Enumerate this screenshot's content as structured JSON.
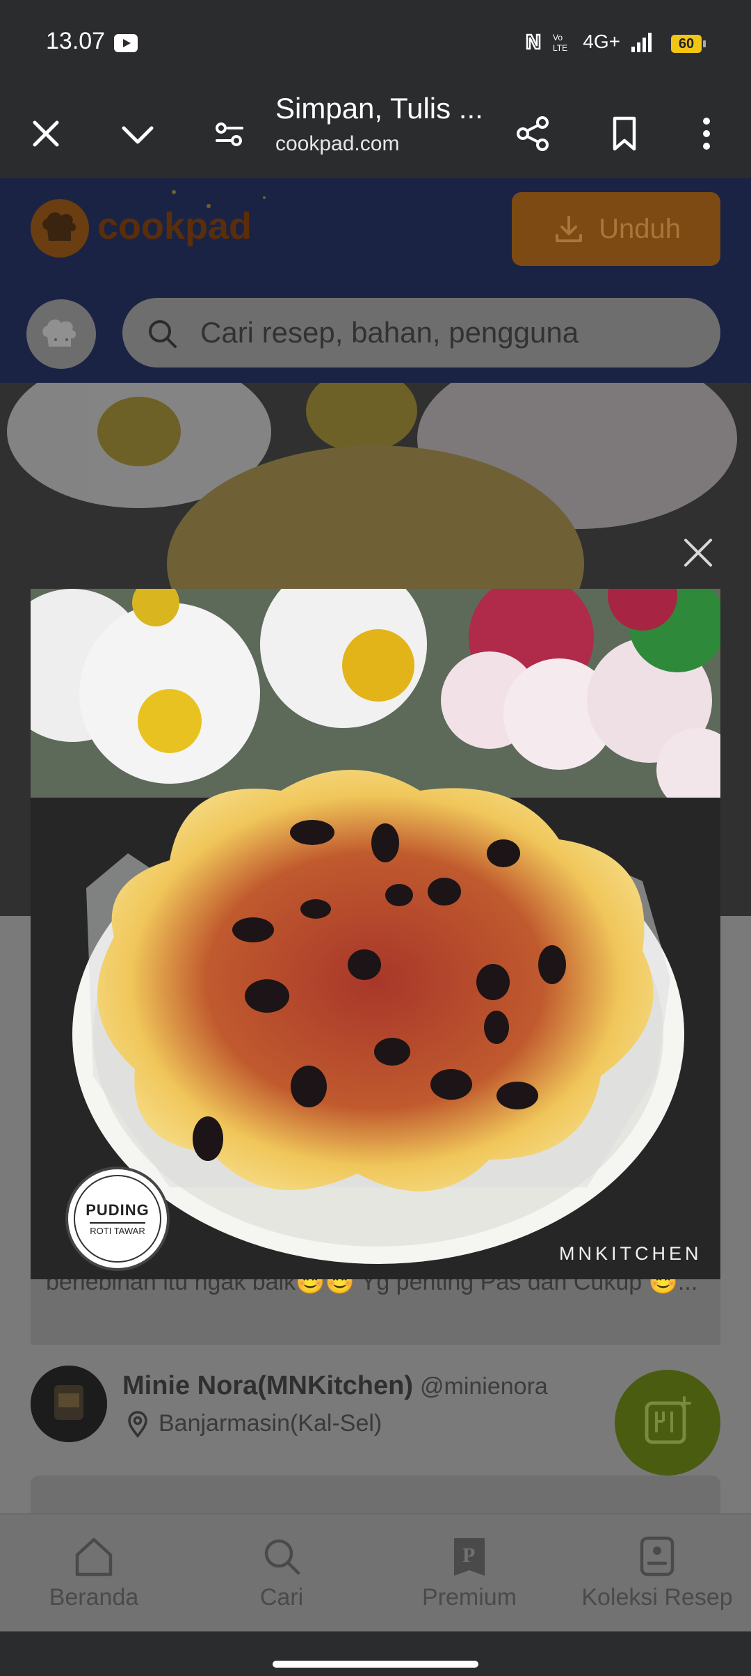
{
  "status_bar": {
    "time": "13.07",
    "network": "4G+",
    "battery": "60",
    "icons": [
      "youtube-icon",
      "nfc-icon",
      "volte-icon",
      "signal-icon",
      "battery-icon"
    ]
  },
  "toolbar": {
    "title": "Simpan, Tulis ...",
    "url": "cookpad.com",
    "icons": [
      "close-icon",
      "chevron-down-icon",
      "page-settings-icon",
      "share-icon",
      "bookmark-icon",
      "more-vert-icon"
    ]
  },
  "page": {
    "brand": "cookpad",
    "download_label": "Unduh",
    "search_placeholder": "Cari resep, bahan, pengguna",
    "description_snippet": "berlebihan itu ngak baik😊😊 Yg penting Pas dan Cukup 😊...",
    "author": {
      "name": "Minie Nora(MNKitchen)",
      "handle": "@minienora",
      "location": "Banjarmasin(Kal-Sel)"
    }
  },
  "photo": {
    "badge_line1": "PUDING",
    "badge_line2": "ROTI TAWAR",
    "watermark": "MNKITCHEN"
  },
  "bottom_nav": [
    {
      "label": "Beranda",
      "icon": "home-icon"
    },
    {
      "label": "Cari",
      "icon": "search-icon"
    },
    {
      "label": "Premium",
      "icon": "premium-icon"
    },
    {
      "label": "Koleksi Resep",
      "icon": "recipe-collection-icon"
    }
  ],
  "colors": {
    "cookpad_orange": "#f68b1f",
    "fab_green": "#9ac81e",
    "chrome_dark": "#2b2c2e"
  }
}
